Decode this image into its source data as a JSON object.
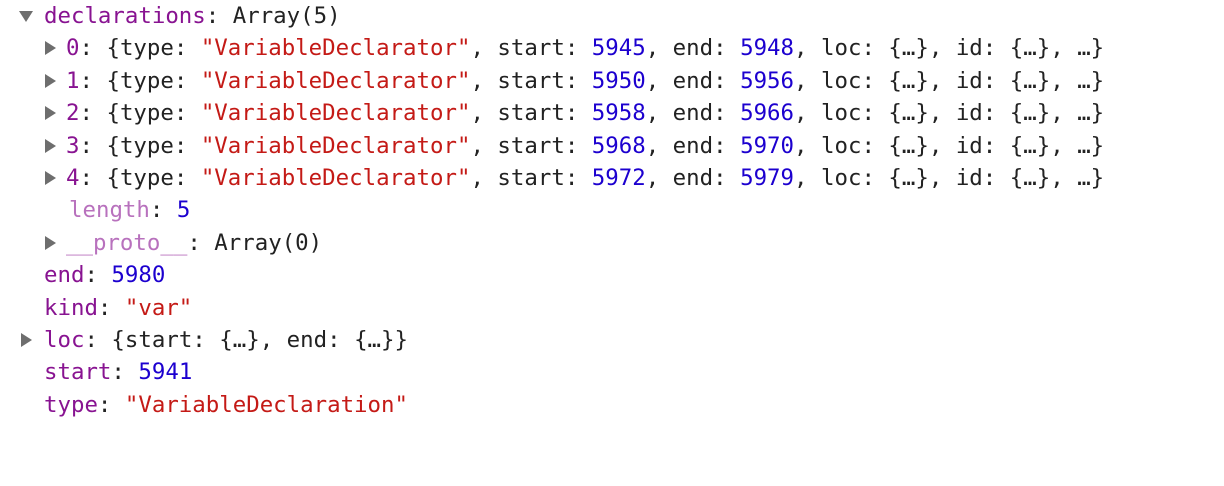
{
  "tree": {
    "declarations": {
      "key": "declarations",
      "summary": "Array(5)",
      "items": [
        {
          "index": "0",
          "type": "\"VariableDeclarator\"",
          "start": "5945",
          "end": "5948"
        },
        {
          "index": "1",
          "type": "\"VariableDeclarator\"",
          "start": "5950",
          "end": "5956"
        },
        {
          "index": "2",
          "type": "\"VariableDeclarator\"",
          "start": "5958",
          "end": "5966"
        },
        {
          "index": "3",
          "type": "\"VariableDeclarator\"",
          "start": "5968",
          "end": "5970"
        },
        {
          "index": "4",
          "type": "\"VariableDeclarator\"",
          "start": "5972",
          "end": "5979"
        }
      ],
      "length_key": "length",
      "length_value": "5",
      "proto_key": "__proto__",
      "proto_value": "Array(0)"
    },
    "end": {
      "key": "end",
      "value": "5980"
    },
    "kind": {
      "key": "kind",
      "value": "\"var\""
    },
    "loc": {
      "key": "loc",
      "summary": "{start: {…}, end: {…}}"
    },
    "start": {
      "key": "start",
      "value": "5941"
    },
    "type": {
      "key": "type",
      "value": "\"VariableDeclaration\""
    }
  },
  "labels": {
    "open_brace": "{",
    "type_key": "type",
    "start_key": "start",
    "end_key": "end",
    "loc_key": "loc",
    "id_key": "id",
    "collapsed": "{…}",
    "tail": "…}"
  },
  "colors": {
    "key": "#881391",
    "key_dim": "#b871bd",
    "string": "#c41a16",
    "number": "#1c00cf",
    "text": "#222222",
    "triangle": "#6e6e6e"
  }
}
